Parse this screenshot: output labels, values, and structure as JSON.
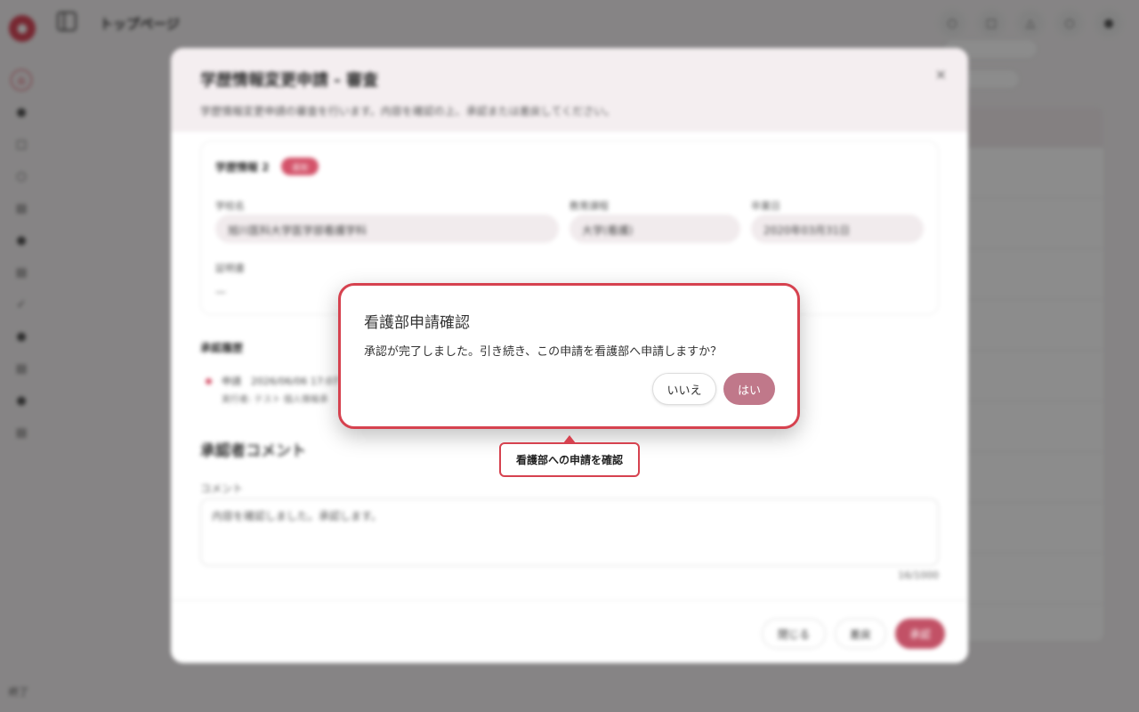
{
  "header": {
    "page_title": "トップページ"
  },
  "sidebar": {
    "footer_label": "終了"
  },
  "modal": {
    "title": "学歴情報変更申請 - 審査",
    "description": "学歴情報変更申請の審査を行います。内容を確認の上、承認または差戻してください。",
    "close_glyph": "×",
    "card": {
      "title": "学歴情報 2",
      "badge": "追加",
      "fields": {
        "school_label": "学校名",
        "school_value": "旭川医科大学医学部看護学科",
        "course_label": "教育課程",
        "course_value": "大学(看護)",
        "grad_label": "卒業日",
        "grad_value": "2020年03月31日"
      },
      "certificate_label": "証明書",
      "certificate_value": "—"
    },
    "history": {
      "label": "承認履歴",
      "line1": "申請　2026/06/06 17:07",
      "line2": "実行者: テスト 個人情報承"
    },
    "comment": {
      "heading": "承認者コメント",
      "label": "コメント",
      "value": "内容を確認しました。承認します。",
      "count": "16/1000"
    },
    "footer": {
      "close_label": "閉じる",
      "reject_label": "差戻",
      "approve_label": "承認"
    }
  },
  "confirm": {
    "title": "看護部申請確認",
    "message": "承認が完了しました。引き続き、この申請を看護部へ申請しますか？",
    "no_label": "いいえ",
    "yes_label": "はい"
  },
  "tooltip": {
    "text": "看護部への申請を確認"
  },
  "colors": {
    "accent": "#d6424f",
    "primary_button": "#c0788a"
  }
}
